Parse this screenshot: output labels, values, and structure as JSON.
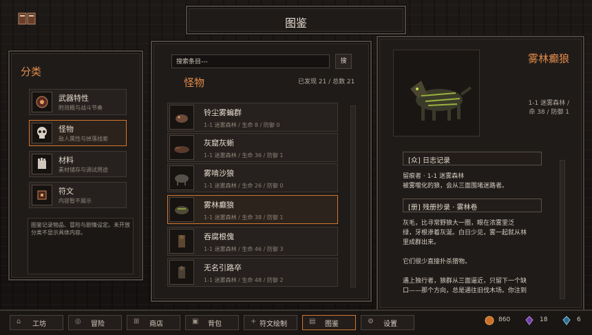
{
  "header": {
    "title": "图鉴"
  },
  "category_panel": {
    "heading": "分类",
    "items": [
      {
        "name": "武器特性",
        "desc": "附效概与战斗节奏"
      },
      {
        "name": "怪物",
        "desc": "敌人属性与掉落线索"
      },
      {
        "name": "材料",
        "desc": "素材储存与调试用途"
      },
      {
        "name": "符文",
        "desc": "内容暂不展示"
      }
    ],
    "info": "图鉴记录物品、冒险与剧情设定。未开放分类不显示具体内容。"
  },
  "list_panel": {
    "search_placeholder": "搜索条目---",
    "search_button": "搜",
    "section_title": "怪物",
    "discovered": "已发现 21 / 总数 21",
    "rows": [
      {
        "name": "铃尘雾蝙群",
        "stats": "1-1 迷雾森林 / 生命 8 / 防御 0"
      },
      {
        "name": "灰窟灰蜥",
        "stats": "1-1 迷雾森林 / 生命 36 / 防御 1"
      },
      {
        "name": "雾啃沙狼",
        "stats": "1-1 迷雾森林 / 生命 26 / 防御 0"
      },
      {
        "name": "雾林癫狼",
        "stats": "1-1 迷雾森林 / 生命 38 / 防御 1"
      },
      {
        "name": "吞腐根傀",
        "stats": "1-1 迷雾森林 / 生命 46 / 防御 3"
      },
      {
        "name": "无名引路卒",
        "stats": "1-1 迷雾森林 / 生命 48 / 防御 2"
      }
    ]
  },
  "detail_panel": {
    "name": "雾林癫狼",
    "line1": "1-1 迷雾森林 /",
    "line2": "命 38 / 防御 1",
    "log_title": "[众] 日志记录",
    "log_lines": [
      "留痕者 · 1-1 迷雾森林",
      "被雾噬化的狼，会从三面围堵迷路者。"
    ],
    "excerpt_title": "[册] 残册抄录 · 雾林卷",
    "excerpt_lines": [
      "灰毛，比寻常野狼大一圈，眼在浓雾里泛",
      "绿，牙根渗着灰涎。白日少见，雾一起就从林",
      "里成群出来。",
      "",
      "它们很少直接扑杀猎物。",
      "",
      "遇上独行者，狼群从三面逼近，只留下一个缺",
      "口——那个方向，总是通往旧伐木场。你注到"
    ]
  },
  "bottom_nav": [
    {
      "glyph": "⌂",
      "label": "工坊"
    },
    {
      "glyph": "◎",
      "label": "冒险"
    },
    {
      "glyph": "⊞",
      "label": "商店"
    },
    {
      "glyph": "▣",
      "label": "背包"
    },
    {
      "glyph": "+",
      "label": "符文绘制"
    },
    {
      "glyph": "▤",
      "label": "图鉴"
    },
    {
      "glyph": "⚙",
      "label": "设置"
    }
  ],
  "resources": {
    "gold": "860",
    "purple": "18",
    "blue": "6"
  },
  "colors": {
    "accent": "#e28d4a",
    "selected_border": "#d2772f",
    "panel": "#1f1b19"
  }
}
